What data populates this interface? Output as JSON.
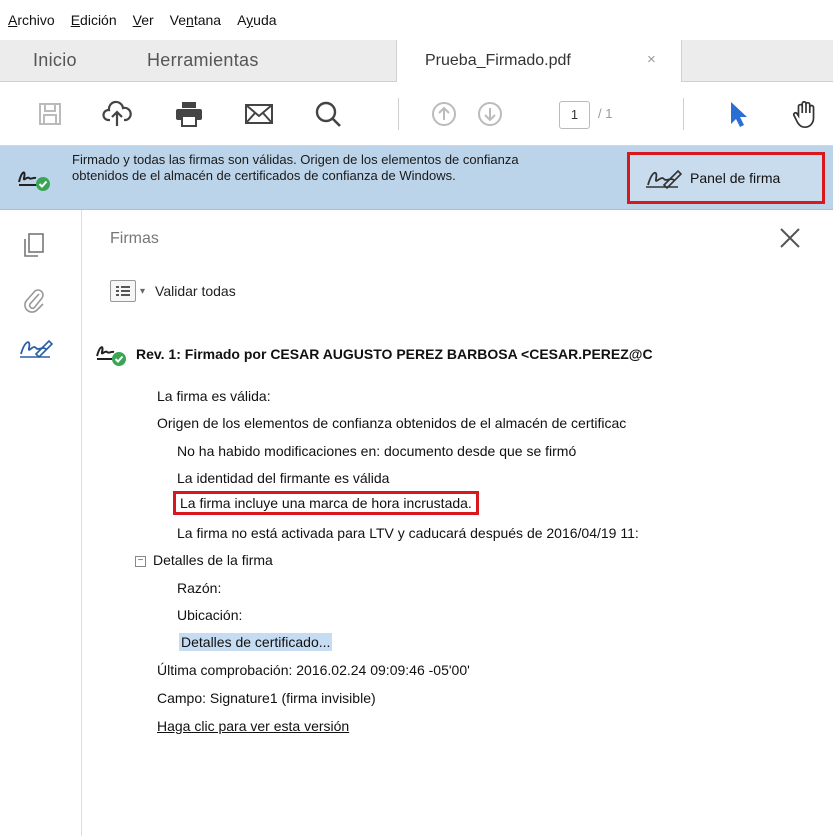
{
  "menu": {
    "items": [
      {
        "label": "Archivo"
      },
      {
        "label": "Edición"
      },
      {
        "label": "Ver"
      },
      {
        "label": "Ventana"
      },
      {
        "label": "Ayuda"
      }
    ]
  },
  "tabs": {
    "home": "Inicio",
    "tools": "Herramientas",
    "document": "Prueba_Firmado.pdf",
    "close_glyph": "×"
  },
  "toolbar": {
    "page_current": "1",
    "page_total": "/ 1",
    "icons": [
      "save-icon",
      "cloud-upload-icon",
      "print-icon",
      "email-icon",
      "search-icon",
      "page-up-icon",
      "page-down-icon",
      "select-arrow-icon",
      "hand-tool-icon"
    ]
  },
  "signature_banner": {
    "message": "Firmado y todas las firmas son válidas. Origen de los elementos de confianza obtenidos de el almacén de certificados de confianza de Windows.",
    "panel_button": "Panel de firma"
  },
  "signatures_panel": {
    "title": "Firmas",
    "validate_all": "Validar todas",
    "revision": "Rev. 1: Firmado por CESAR AUGUSTO PEREZ BARBOSA <CESAR.PEREZ@C",
    "details": [
      "La firma es válida:",
      "Origen de los elementos de confianza obtenidos de el almacén de certificac",
      "No ha habido modificaciones en: documento desde que se firmó",
      "La identidad del firmante es válida",
      "La firma incluye una marca de hora incrustada.",
      "La firma no está activada para LTV y caducará después de 2016/04/19 11:"
    ],
    "signature_details": {
      "header": "Detalles de la firma",
      "reason": "Razón:",
      "location": "Ubicación:",
      "certificate_details": "Detalles de certificado..."
    },
    "last_check": "Última comprobación: 2016.02.24 09:09:46 -05'00'",
    "field": "Campo: Signature1 (firma invisible)",
    "view_version": "Haga clic para ver esta versión"
  },
  "colors": {
    "banner_bg": "#bcd4e9",
    "highlight_red": "#d8181d",
    "valid_green": "#3aa655",
    "select_blue": "#2a6fd6"
  }
}
